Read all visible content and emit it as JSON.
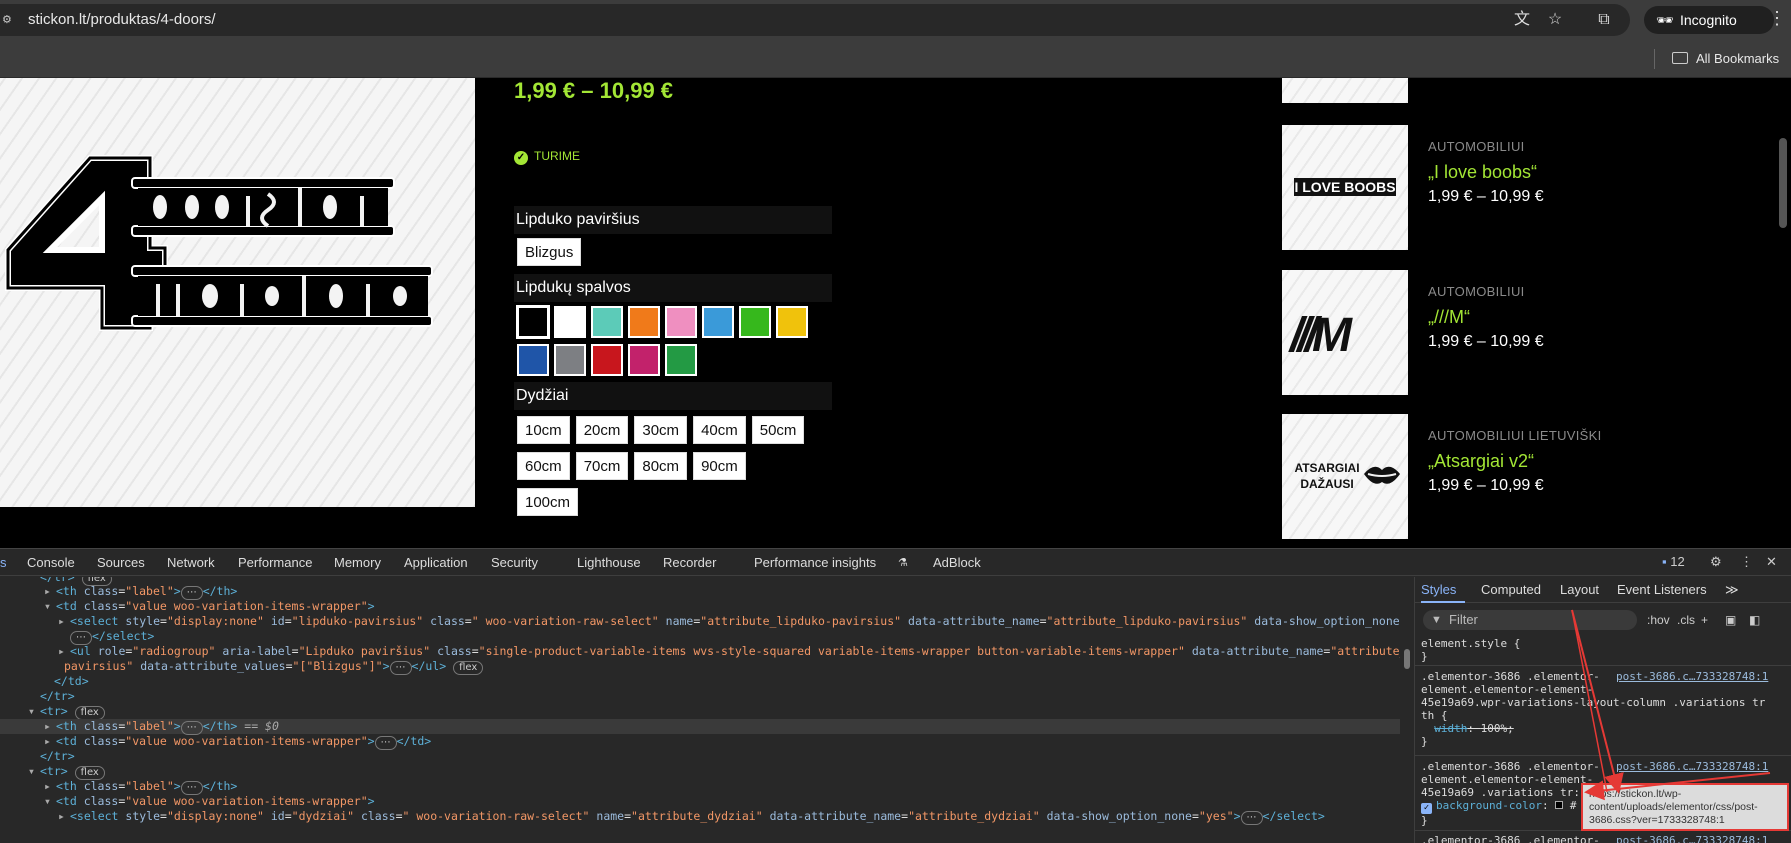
{
  "browser": {
    "url": "stickon.lt/produktas/4-doors/",
    "incognito_label": "Incognito",
    "bookmarks_label": "All Bookmarks"
  },
  "product": {
    "logo_alt": "4 doors for more whores",
    "price_range": "1,99 € – 10,99 €",
    "stock_status": "TURIME",
    "surface": {
      "label": "Lipduko paviršius",
      "options": [
        "Blizgus"
      ]
    },
    "colors": {
      "label": "Lipdukų spalvos",
      "swatches": [
        "#000000",
        "#ffffff",
        "#5ccbb8",
        "#f07a1a",
        "#ef8fc0",
        "#3a9ad9",
        "#36b81c",
        "#f0c20c",
        "#1f55a8",
        "#7d7f83",
        "#c8161d",
        "#c2226b",
        "#239a44"
      ]
    },
    "sizes": {
      "label": "Dydžiai",
      "options": [
        "10cm",
        "20cm",
        "30cm",
        "40cm",
        "50cm",
        "60cm",
        "70cm",
        "80cm",
        "90cm",
        "100cm"
      ]
    }
  },
  "related": [
    {
      "category": "AUTOMOBILIUI",
      "title": "„I love boobs“",
      "price": "1,99 € – 10,99 €",
      "thumb_text": "I LOVE BOOBS"
    },
    {
      "category": "AUTOMOBILIUI",
      "title": "„///M“",
      "price": "1,99 € – 10,99 €",
      "thumb_text": "///M"
    },
    {
      "category": "AUTOMOBILIUI LIETUVIŠKI",
      "title": "„Atsargiai v2“",
      "price": "1,99 € – 10,99 €",
      "thumb_text": "ATSARGIAI DAŽAUSI"
    }
  ],
  "devtools": {
    "tabs": [
      "Console",
      "Sources",
      "Network",
      "Performance",
      "Memory",
      "Application",
      "Security",
      "Lighthouse",
      "Recorder",
      "Performance insights",
      "AdBlock"
    ],
    "issues_count": "12",
    "styles_tabs": [
      "Styles",
      "Computed",
      "Layout",
      "Event Listeners"
    ],
    "filter_placeholder": "Filter",
    "hov": ":hov",
    "cls": ".cls",
    "element_style": "element.style {",
    "rule1_selector_1": ".elementor-3686 .elementor-",
    "rule1_selector_2": "element.elementor-element-",
    "rule1_selector_3": "45e19a69.wpr-variations-layout-column .variations tr",
    "rule1_selector_4": "th {",
    "rule1_prop": "width",
    "rule1_value": "100%;",
    "rule_source": "post-3686.c…733328748:1",
    "rule2_selector_1": ".elementor-3686 .elementor-",
    "rule2_selector_2": "element.elementor-element-",
    "rule2_selector_3": "45e19a69 .variations tr:",
    "rule2_prop": "background-color",
    "rule3_selector_1": ".elementor-3686 .elementor-",
    "tooltip": "https://stickon.lt/wp-content/uploads/elementor/css/post-3686.css?ver=1733328748:1",
    "dom": {
      "th_label": "label",
      "td_class": "value woo-variation-items-wrapper",
      "select1_style": "display:none",
      "select1_id": "lipduko-pavirsius",
      "select_class": " woo-variation-raw-select",
      "select1_name": "attribute_lipduko-pavirsius",
      "select1_attr": "attribute_lipduko-pavirsius",
      "show_option_none": "yes",
      "ul_role": "radiogroup",
      "ul_aria": "Lipduko paviršius",
      "ul_class": "single-product-variable-items wvs-style-squared variable-items-wrapper button-variable-items-wrapper",
      "ul_attr_name": "attribute_lipduko-",
      "ul_attr_name_2": "pavirsius",
      "ul_values": "[\"Blizgus\"]",
      "select2_id": "dydziai",
      "select2_name": "attribute_dydziai",
      "select2_attr": "attribute_dydziai",
      "flex": "flex",
      "dollar0": "== $0"
    }
  }
}
